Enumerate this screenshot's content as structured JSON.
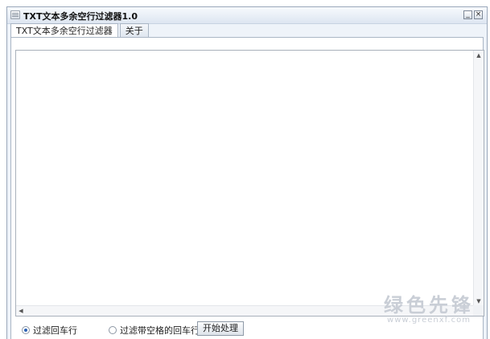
{
  "window": {
    "title": "TXT文本多余空行过滤器1.0",
    "minimize_glyph": "_",
    "close_glyph": "×"
  },
  "tabs": [
    {
      "label": "TXT文本多余空行过滤器",
      "active": true
    },
    {
      "label": "关于",
      "active": false
    }
  ],
  "editor": {
    "content": ""
  },
  "options": {
    "radio1_label": "过滤回车行",
    "radio1_checked": true,
    "radio2_label": "过滤带空格的回车行",
    "radio2_checked": false,
    "start_button_label": "开始处理"
  },
  "watermark": {
    "main": "绿色先锋",
    "sub": "www.greenxf.com"
  },
  "icons": {
    "app": "document-icon",
    "scroll_up": "arrow-up-icon",
    "scroll_down": "arrow-down-icon",
    "scroll_left": "arrow-left-icon"
  }
}
